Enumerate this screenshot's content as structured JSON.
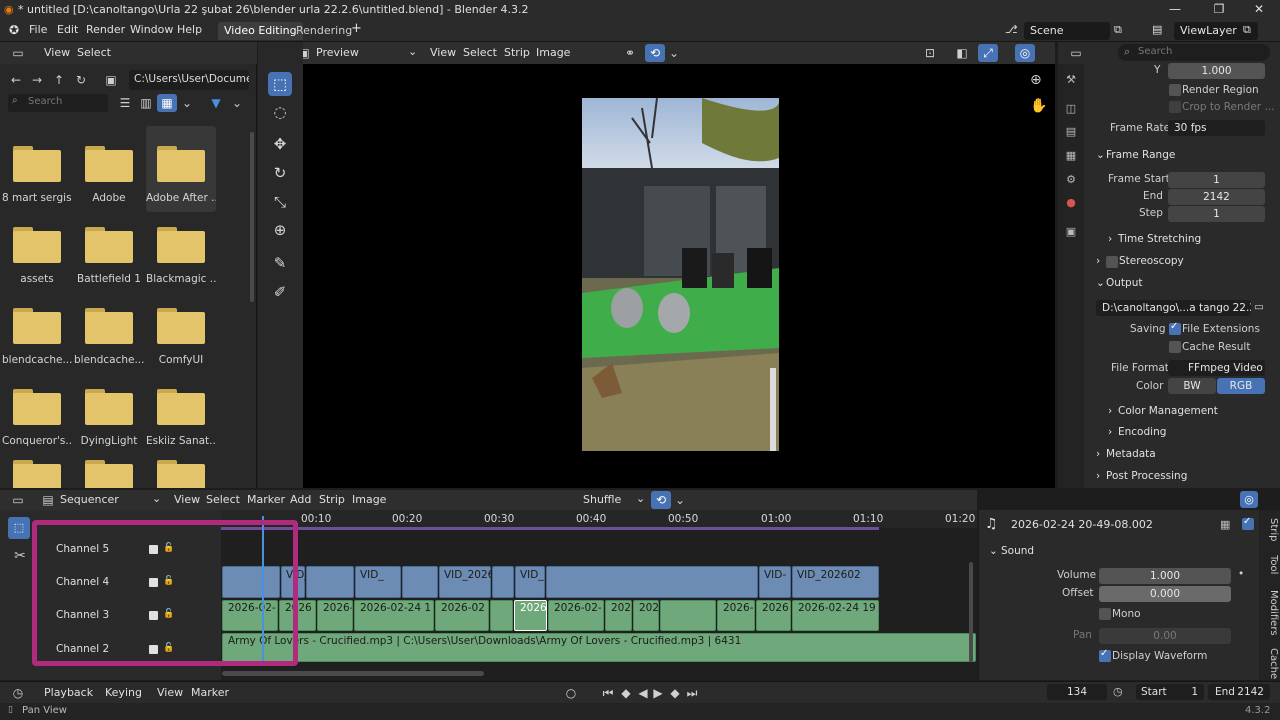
{
  "titlebar": {
    "title": "* untitled [D:\\canoltango\\Urla 22 şubat 26\\blender urla 22.2.6\\untitled.blend] - Blender 4.3.2",
    "minimize": "—",
    "maximize": "❐",
    "close": "✕"
  },
  "menubar": {
    "items": [
      "File",
      "Edit",
      "Render",
      "Window",
      "Help"
    ],
    "workspaces": [
      "Video Editing",
      "Rendering"
    ],
    "add_workspace": "+",
    "scene": "Scene",
    "view_layer": "ViewLayer"
  },
  "filebrowser": {
    "header": [
      "View",
      "Select"
    ],
    "path": "C:\\Users\\User\\Docume...",
    "search_placeholder": "Search",
    "folders": [
      "8 mart sergisi",
      "Adobe",
      "Adobe After ...",
      "assets",
      "Battlefield 1",
      "Blackmagic ...",
      "blendcache...",
      "blendcache...",
      "ComfyUI",
      "Conqueror's...",
      "DyingLight",
      "Eskiiz Sanat..."
    ]
  },
  "preview": {
    "mode": "Preview",
    "menu": [
      "View",
      "Select",
      "Strip",
      "Image"
    ]
  },
  "properties": {
    "search_placeholder": "Search",
    "y_label": "Y",
    "y_value": "1.000",
    "render_region": "Render Region",
    "crop_to_render": "Crop to Render ...",
    "frame_rate_label": "Frame Rate",
    "frame_rate_value": "30 fps",
    "frame_range": "Frame Range",
    "frame_start_label": "Frame Start",
    "frame_start": "1",
    "end_label": "End",
    "end": "2142",
    "step_label": "Step",
    "step": "1",
    "time_stretching": "Time Stretching",
    "stereoscopy": "Stereoscopy",
    "output": "Output",
    "output_path": "D:\\canoltango\\...a tango 22.2.26",
    "saving_label": "Saving",
    "file_extensions": "File Extensions",
    "cache_result": "Cache Result",
    "file_format_label": "File Format",
    "file_format": "FFmpeg Video",
    "color_label": "Color",
    "color_bw": "BW",
    "color_rgb": "RGB",
    "color_management": "Color Management",
    "encoding": "Encoding",
    "metadata": "Metadata",
    "post_processing": "Post Processing"
  },
  "sequencer": {
    "editor": "Sequencer",
    "menu": [
      "View",
      "Select",
      "Marker",
      "Add",
      "Strip",
      "Image"
    ],
    "snap": "Shuffle",
    "ruler": [
      "00:10",
      "00:20",
      "00:30",
      "00:40",
      "00:50",
      "01:00",
      "01:10",
      "01:20"
    ],
    "channels": [
      "Channel 5",
      "Channel 4",
      "Channel 3",
      "Channel 2"
    ],
    "video_strips": [
      "VID_",
      "VID_",
      "VID_2026",
      "VID_",
      "VID-",
      "VID_202602"
    ],
    "audio_strips": [
      "2026-02-",
      "2026",
      "2026-",
      "2026-02-24 1",
      "2026-02",
      "2026",
      "2026-02-",
      "202",
      "202",
      "2026-",
      "2026",
      "2026-02-24 19"
    ],
    "music_strip": "Army Of Lovers - Crucified.mp3 | C:\\Users\\User\\Downloads\\Army Of Lovers - Crucified.mp3 | 6431"
  },
  "strip_panel": {
    "strip_name": "2026-02-24 20-49-08.002",
    "sound": "Sound",
    "volume_label": "Volume",
    "volume": "1.000",
    "offset_label": "Offset",
    "offset": "0.000",
    "mono": "Mono",
    "pan_label": "Pan",
    "pan": "0.00",
    "display_waveform": "Display Waveform",
    "tabs": [
      "Strip",
      "Tool",
      "Modifiers",
      "Cache"
    ]
  },
  "timeline": {
    "menu": [
      "Playback",
      "Keying",
      "View",
      "Marker"
    ],
    "current_frame": "134",
    "start_label": "Start",
    "start": "1",
    "end_label": "End",
    "end": "2142"
  },
  "statusbar": {
    "hint": "Pan View",
    "version": "4.3.2"
  }
}
